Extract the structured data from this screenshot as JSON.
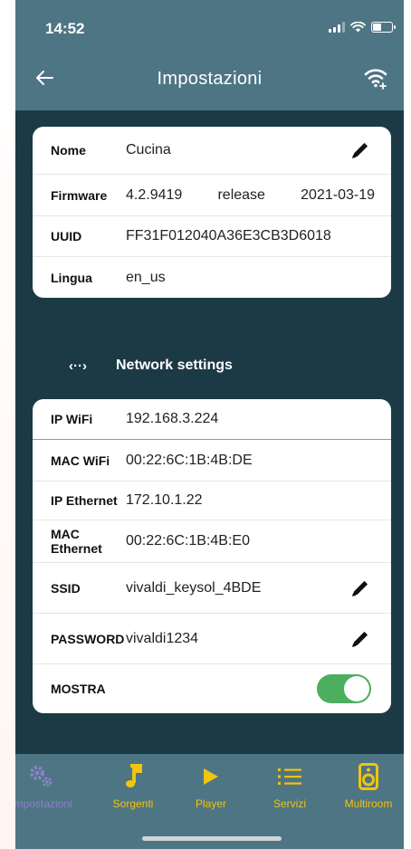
{
  "status_bar": {
    "time": "14:52"
  },
  "header": {
    "title": "Impostazioni"
  },
  "device_info": {
    "rows": [
      {
        "label": "Nome",
        "value": "Cucina",
        "editable": true
      },
      {
        "label": "Firmware",
        "version": "4.2.9419",
        "channel": "release",
        "date": "2021-03-19"
      },
      {
        "label": "UUID",
        "value": "FF31F012040A36E3CB3D6018"
      },
      {
        "label": "Lingua",
        "value": "en_us"
      }
    ]
  },
  "network": {
    "section_icon": "code-brackets-icon",
    "section_title": "Network settings",
    "rows": [
      {
        "label": "IP WiFi",
        "value": "192.168.3.224"
      },
      {
        "label": "MAC WiFi",
        "value": "00:22:6C:1B:4B:DE"
      },
      {
        "label": "IP Ethernet",
        "value": "172.10.1.22"
      },
      {
        "label": "MAC Ethernet",
        "value": "00:22:6C:1B:4B:E0"
      },
      {
        "label": "SSID",
        "value": "vivaldi_keysol_4BDE",
        "editable": true
      },
      {
        "label": "PASSWORD",
        "value": "vivaldi1234",
        "editable": true
      },
      {
        "label": "MOSTRA",
        "toggle_on": true
      }
    ]
  },
  "bottom_nav": {
    "items": [
      {
        "label": "Impostazioni",
        "icon": "gears-icon",
        "active": true
      },
      {
        "label": "Sorgenti",
        "icon": "music-note-icon"
      },
      {
        "label": "Player",
        "icon": "play-icon"
      },
      {
        "label": "Servizi",
        "icon": "list-icon"
      },
      {
        "label": "Multiroom",
        "icon": "speaker-icon"
      }
    ]
  },
  "colors": {
    "header": "#4e7584",
    "background": "#1c3a45",
    "accent": "#f1c40f",
    "active_nav": "#8a83c6",
    "toggle_on": "#4cae5f"
  }
}
